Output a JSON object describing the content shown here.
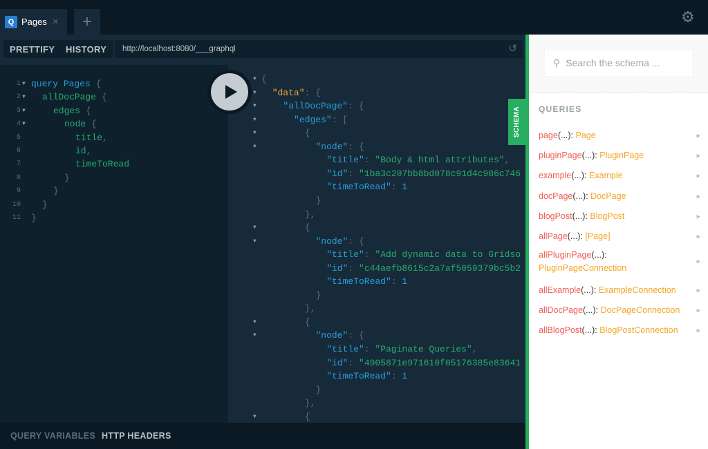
{
  "tabs": [
    {
      "icon": "Q",
      "title": "Pages",
      "close": "×"
    }
  ],
  "new_tab": "+",
  "toolbar": {
    "prettify": "PRETTIFY",
    "history": "HISTORY",
    "url": "http://localhost:8080/___graphql"
  },
  "query_lines": [
    {
      "n": "1",
      "fold": true,
      "indent": 0,
      "tokens": [
        [
          "kw",
          "query "
        ],
        [
          "kw",
          "Pages"
        ],
        [
          "pun",
          " {"
        ]
      ]
    },
    {
      "n": "2",
      "fold": true,
      "indent": 1,
      "tokens": [
        [
          "fld",
          "allDocPage"
        ],
        [
          "pun",
          " {"
        ]
      ]
    },
    {
      "n": "3",
      "fold": true,
      "indent": 2,
      "tokens": [
        [
          "fld",
          "edges"
        ],
        [
          "pun",
          " {"
        ]
      ]
    },
    {
      "n": "4",
      "fold": true,
      "indent": 3,
      "tokens": [
        [
          "fld",
          "node"
        ],
        [
          "pun",
          " {"
        ]
      ]
    },
    {
      "n": "5",
      "fold": false,
      "indent": 4,
      "tokens": [
        [
          "fld",
          "title"
        ],
        [
          "pun",
          ","
        ]
      ]
    },
    {
      "n": "6",
      "fold": false,
      "indent": 4,
      "tokens": [
        [
          "fld",
          "id"
        ],
        [
          "pun",
          ","
        ]
      ]
    },
    {
      "n": "7",
      "fold": false,
      "indent": 4,
      "tokens": [
        [
          "fld",
          "timeToRead"
        ]
      ]
    },
    {
      "n": "8",
      "fold": false,
      "indent": 3,
      "tokens": [
        [
          "pun",
          "}"
        ]
      ]
    },
    {
      "n": "9",
      "fold": false,
      "indent": 2,
      "tokens": [
        [
          "pun",
          "}"
        ]
      ]
    },
    {
      "n": "10",
      "fold": false,
      "indent": 1,
      "tokens": [
        [
          "pun",
          "}"
        ]
      ]
    },
    {
      "n": "11",
      "fold": false,
      "indent": 0,
      "tokens": [
        [
          "pun",
          "}"
        ]
      ]
    }
  ],
  "result_lines": [
    {
      "fold": true,
      "indent": 0,
      "tokens": [
        [
          "pun",
          "{"
        ]
      ]
    },
    {
      "fold": true,
      "indent": 1,
      "tokens": [
        [
          "dkey",
          "\"data\""
        ],
        [
          "pun",
          ": {"
        ]
      ]
    },
    {
      "fold": true,
      "indent": 2,
      "tokens": [
        [
          "key",
          "\"allDocPage\""
        ],
        [
          "pun",
          ": {"
        ]
      ]
    },
    {
      "fold": true,
      "indent": 3,
      "tokens": [
        [
          "key",
          "\"edges\""
        ],
        [
          "pun",
          ": ["
        ]
      ]
    },
    {
      "fold": true,
      "indent": 4,
      "tokens": [
        [
          "pun",
          "{"
        ]
      ]
    },
    {
      "fold": true,
      "indent": 5,
      "tokens": [
        [
          "key",
          "\"node\""
        ],
        [
          "pun",
          ": {"
        ]
      ]
    },
    {
      "fold": false,
      "indent": 6,
      "tokens": [
        [
          "key",
          "\"title\""
        ],
        [
          "pun",
          ": "
        ],
        [
          "str",
          "\"Body & html attributes\""
        ],
        [
          "pun",
          ","
        ]
      ]
    },
    {
      "fold": false,
      "indent": 6,
      "tokens": [
        [
          "key",
          "\"id\""
        ],
        [
          "pun",
          ": "
        ],
        [
          "str",
          "\"1ba3c207bb8bd078c91d4c986c746"
        ]
      ]
    },
    {
      "fold": false,
      "indent": 6,
      "tokens": [
        [
          "key",
          "\"timeToRead\""
        ],
        [
          "pun",
          ": "
        ],
        [
          "num",
          "1"
        ]
      ]
    },
    {
      "fold": false,
      "indent": 5,
      "tokens": [
        [
          "pun",
          "}"
        ]
      ]
    },
    {
      "fold": false,
      "indent": 4,
      "tokens": [
        [
          "pun",
          "},"
        ]
      ]
    },
    {
      "fold": true,
      "indent": 4,
      "tokens": [
        [
          "pun",
          "{"
        ]
      ]
    },
    {
      "fold": true,
      "indent": 5,
      "tokens": [
        [
          "key",
          "\"node\""
        ],
        [
          "pun",
          ": {"
        ]
      ]
    },
    {
      "fold": false,
      "indent": 6,
      "tokens": [
        [
          "key",
          "\"title\""
        ],
        [
          "pun",
          ": "
        ],
        [
          "str",
          "\"Add dynamic data to Gridso"
        ]
      ]
    },
    {
      "fold": false,
      "indent": 6,
      "tokens": [
        [
          "key",
          "\"id\""
        ],
        [
          "pun",
          ": "
        ],
        [
          "str",
          "\"c44aefb8615c2a7af5059379bc5b2"
        ]
      ]
    },
    {
      "fold": false,
      "indent": 6,
      "tokens": [
        [
          "key",
          "\"timeToRead\""
        ],
        [
          "pun",
          ": "
        ],
        [
          "num",
          "1"
        ]
      ]
    },
    {
      "fold": false,
      "indent": 5,
      "tokens": [
        [
          "pun",
          "}"
        ]
      ]
    },
    {
      "fold": false,
      "indent": 4,
      "tokens": [
        [
          "pun",
          "},"
        ]
      ]
    },
    {
      "fold": true,
      "indent": 4,
      "tokens": [
        [
          "pun",
          "{"
        ]
      ]
    },
    {
      "fold": true,
      "indent": 5,
      "tokens": [
        [
          "key",
          "\"node\""
        ],
        [
          "pun",
          ": {"
        ]
      ]
    },
    {
      "fold": false,
      "indent": 6,
      "tokens": [
        [
          "key",
          "\"title\""
        ],
        [
          "pun",
          ": "
        ],
        [
          "str",
          "\"Paginate Queries\""
        ],
        [
          "pun",
          ","
        ]
      ]
    },
    {
      "fold": false,
      "indent": 6,
      "tokens": [
        [
          "key",
          "\"id\""
        ],
        [
          "pun",
          ": "
        ],
        [
          "str",
          "\"4905871e971610f05176385e83641"
        ]
      ]
    },
    {
      "fold": false,
      "indent": 6,
      "tokens": [
        [
          "key",
          "\"timeToRead\""
        ],
        [
          "pun",
          ": "
        ],
        [
          "num",
          "1"
        ]
      ]
    },
    {
      "fold": false,
      "indent": 5,
      "tokens": [
        [
          "pun",
          "}"
        ]
      ]
    },
    {
      "fold": false,
      "indent": 4,
      "tokens": [
        [
          "pun",
          "},"
        ]
      ]
    },
    {
      "fold": true,
      "indent": 4,
      "tokens": [
        [
          "pun",
          "{"
        ]
      ]
    }
  ],
  "schema_tab": "SCHEMA",
  "bottom": {
    "query_variables": "QUERY VARIABLES",
    "http_headers": "HTTP HEADERS"
  },
  "schema_panel": {
    "search_placeholder": "Search the schema ...",
    "section": "QUERIES",
    "queries": [
      {
        "name": "page",
        "args": "(...): ",
        "type": "Page"
      },
      {
        "name": "pluginPage",
        "args": "(...): ",
        "type": "PluginPage"
      },
      {
        "name": "example",
        "args": "(...): ",
        "type": "Example"
      },
      {
        "name": "docPage",
        "args": "(...): ",
        "type": "DocPage"
      },
      {
        "name": "blogPost",
        "args": "(...): ",
        "type": "BlogPost"
      },
      {
        "name": "allPage",
        "args": "(...): ",
        "type": "[Page]"
      },
      {
        "name": "allPluginPage",
        "args": "(...): ",
        "type": "PluginPageConnection"
      },
      {
        "name": "allExample",
        "args": "(...): ",
        "type": "ExampleConnection"
      },
      {
        "name": "allDocPage",
        "args": "(...): ",
        "type": "DocPageConnection"
      },
      {
        "name": "allBlogPost",
        "args": "(...): ",
        "type": "BlogPostConnection"
      }
    ]
  },
  "colors": {
    "accent": "#27ae60",
    "field": "#26ad6b",
    "keyword": "#2a9ed8",
    "query_name": "#f25c54",
    "query_type": "#f5a623"
  }
}
